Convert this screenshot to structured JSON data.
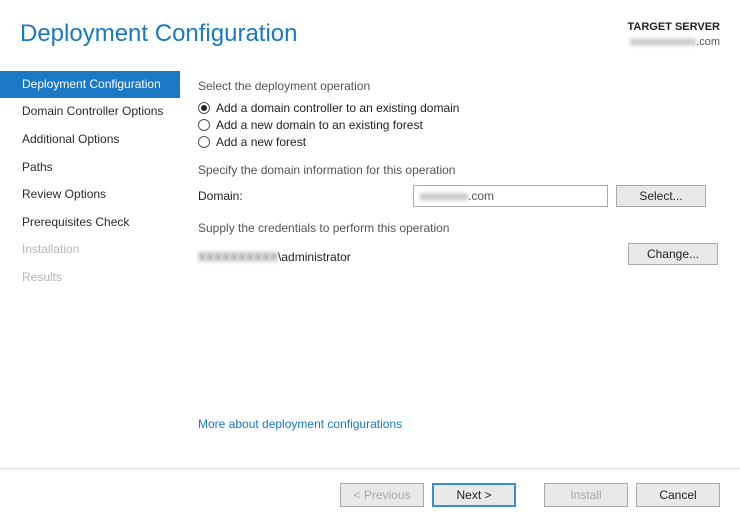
{
  "header": {
    "title": "Deployment Configuration",
    "target_label": "TARGET SERVER",
    "target_host_blurred": "xxxxxxxxxxxx",
    "target_host_suffix": ".com"
  },
  "sidebar": {
    "steps": [
      {
        "label": "Deployment Configuration",
        "state": "active"
      },
      {
        "label": "Domain Controller Options",
        "state": "normal"
      },
      {
        "label": "Additional Options",
        "state": "normal"
      },
      {
        "label": "Paths",
        "state": "normal"
      },
      {
        "label": "Review Options",
        "state": "normal"
      },
      {
        "label": "Prerequisites Check",
        "state": "normal"
      },
      {
        "label": "Installation",
        "state": "disabled"
      },
      {
        "label": "Results",
        "state": "disabled"
      }
    ]
  },
  "main": {
    "select_op_label": "Select the deployment operation",
    "options": [
      {
        "label": "Add a domain controller to an existing domain",
        "selected": true
      },
      {
        "label": "Add a new domain to an existing forest",
        "selected": false
      },
      {
        "label": "Add a new forest",
        "selected": false
      }
    ],
    "domain_section_label": "Specify the domain information for this operation",
    "domain_field_label": "Domain:",
    "domain_value_blurred": "xxxxxxxx",
    "domain_value_suffix": ".com",
    "select_button": "Select...",
    "cred_section_label": "Supply the credentials to perform this operation",
    "cred_value_blurred": "XXXXXXXXXX",
    "cred_value_suffix": "\\administrator",
    "change_button": "Change...",
    "more_link": "More about deployment configurations"
  },
  "footer": {
    "previous": "< Previous",
    "next": "Next >",
    "install": "Install",
    "cancel": "Cancel"
  }
}
